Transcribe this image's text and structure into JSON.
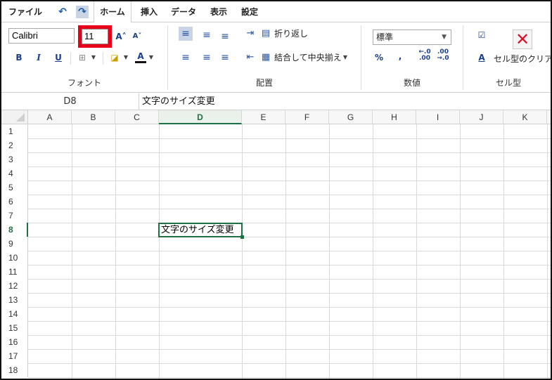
{
  "menubar": {
    "items": [
      {
        "label": "ファイル"
      },
      {
        "label": "ホーム"
      },
      {
        "label": "挿入"
      },
      {
        "label": "データ"
      },
      {
        "label": "表示"
      },
      {
        "label": "設定"
      }
    ],
    "undo_icon": "↶",
    "redo_icon": "↷"
  },
  "ribbon": {
    "font": {
      "name": "Calibri",
      "size": "11",
      "grow_icon": "A˄",
      "shrink_icon": "A˅",
      "bold": "B",
      "italic": "I",
      "underline": "U",
      "border_icon": "⊞",
      "fill_icon": "◪",
      "color_icon": "A",
      "label": "フォント"
    },
    "alignment": {
      "wrap_label": "折り返し",
      "merge_label": "結合して中央揃え",
      "label": "配置"
    },
    "number": {
      "format": "標準",
      "percent": "%",
      "comma": ",",
      "inc_decimal": "←.0\n.00",
      "dec_decimal": ".00\n→.0",
      "label": "数値"
    },
    "cells": {
      "clear_label": "セル型のクリア",
      "label": "セル型"
    }
  },
  "formula_bar": {
    "cell_ref": "D8",
    "content": "文字のサイズ変更"
  },
  "grid": {
    "columns": [
      "A",
      "B",
      "C",
      "D",
      "E",
      "F",
      "G",
      "H",
      "I",
      "J",
      "K"
    ],
    "rows": [
      "1",
      "2",
      "3",
      "4",
      "5",
      "6",
      "7",
      "8",
      "9",
      "10",
      "11",
      "12",
      "13",
      "14",
      "15",
      "16",
      "17",
      "18"
    ],
    "active_column": "D",
    "active_row": "8",
    "active_cell_value": "文字のサイズ変更"
  },
  "colors": {
    "accent_green": "#1e7145",
    "highlight_red": "#e8001b",
    "ribbon_blue": "#1a3f8a"
  }
}
